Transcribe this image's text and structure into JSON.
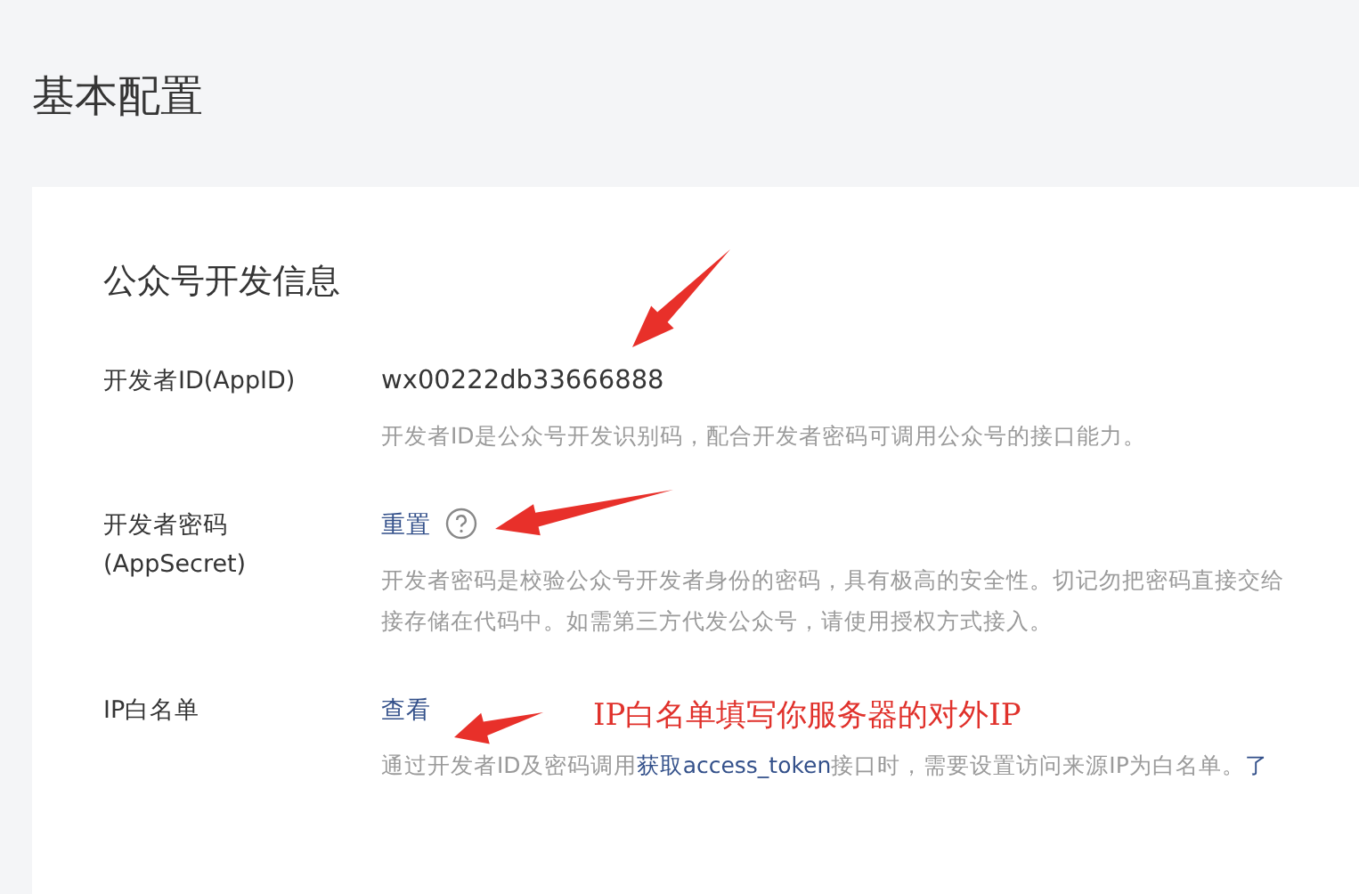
{
  "page_title": "基本配置",
  "section": {
    "title": "公众号开发信息",
    "fields": [
      {
        "kind": "text",
        "label": [
          "开发者ID(AppID)"
        ],
        "value": "wx00222db33666888",
        "help": [
          [
            {
              "text": "开发者ID是公众号开发识别码，配合开发者密码可调用公众号的接口能力。"
            }
          ]
        ]
      },
      {
        "kind": "link",
        "label": [
          "开发者密码",
          "(AppSecret)"
        ],
        "value": "重置",
        "help_icon": true,
        "help": [
          [
            {
              "text": "开发者密码是校验公众号开发者身份的密码，具有极高的安全性。切记勿把密码直接交给"
            }
          ],
          [
            {
              "text": "接存储在代码中。如需第三方代发公众号，请使用授权方式接入。"
            }
          ]
        ]
      },
      {
        "kind": "link",
        "label": [
          "IP白名单"
        ],
        "value": "查看",
        "help_icon": false,
        "help": [
          [
            {
              "text": "通过开发者ID及密码调用"
            },
            {
              "text": "获取access_token",
              "link": true
            },
            {
              "text": "接口时，需要设置访问来源IP为白名单。"
            },
            {
              "text": "了",
              "link": true
            }
          ]
        ]
      }
    ]
  },
  "annotations": [
    {
      "kind": "arrow"
    },
    {
      "kind": "arrow"
    },
    {
      "kind": "arrow"
    },
    {
      "kind": "note",
      "text": "IP白名单填写你服务器的对外IP"
    }
  ]
}
